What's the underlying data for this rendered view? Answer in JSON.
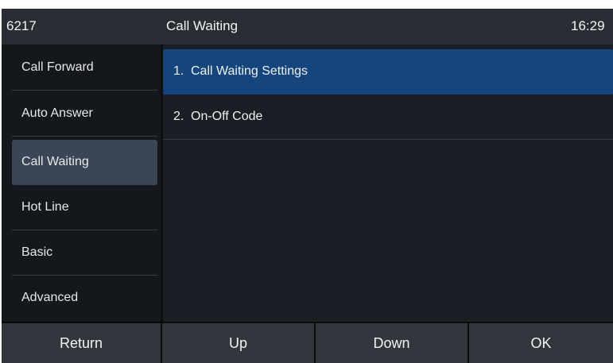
{
  "header": {
    "extension": "6217",
    "title": "Call Waiting",
    "clock": "16:29"
  },
  "sidebar": {
    "items": [
      {
        "label": "Call Forward"
      },
      {
        "label": "Auto Answer"
      },
      {
        "label": "Call Waiting"
      },
      {
        "label": "Hot Line"
      },
      {
        "label": "Basic"
      },
      {
        "label": "Advanced"
      }
    ],
    "active": "Call Waiting"
  },
  "menu": {
    "items": [
      {
        "index": "1.",
        "label": "Call Waiting Settings"
      },
      {
        "index": "2.",
        "label": "On-Off Code"
      }
    ],
    "selected": "Call Waiting Settings"
  },
  "softkeys": [
    {
      "label": "Return"
    },
    {
      "label": "Up"
    },
    {
      "label": "Down"
    },
    {
      "label": "OK"
    }
  ],
  "colors": {
    "header_bg": "#2a2e34",
    "selected_row": "#14457c",
    "active_sidebar": "#3a4656",
    "softkey_bg": "#33373d"
  }
}
